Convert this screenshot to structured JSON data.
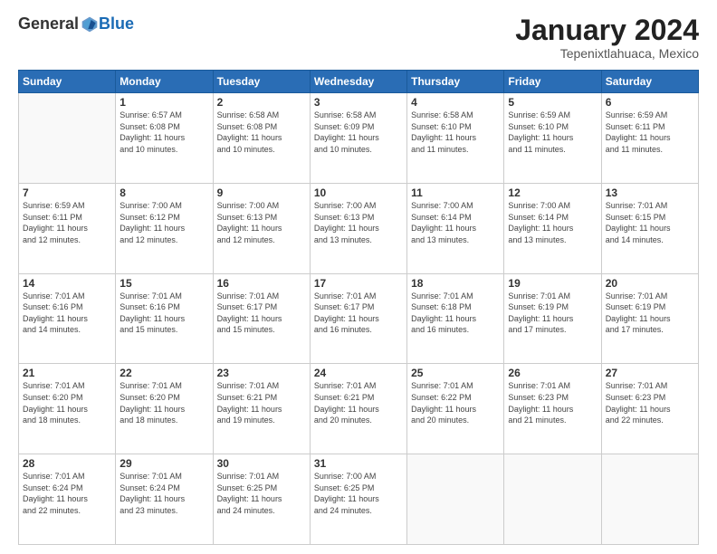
{
  "logo": {
    "general": "General",
    "blue": "Blue"
  },
  "header": {
    "month": "January 2024",
    "location": "Tepenixtlahuaca, Mexico"
  },
  "weekdays": [
    "Sunday",
    "Monday",
    "Tuesday",
    "Wednesday",
    "Thursday",
    "Friday",
    "Saturday"
  ],
  "weeks": [
    [
      {
        "day": "",
        "info": ""
      },
      {
        "day": "1",
        "info": "Sunrise: 6:57 AM\nSunset: 6:08 PM\nDaylight: 11 hours\nand 10 minutes."
      },
      {
        "day": "2",
        "info": "Sunrise: 6:58 AM\nSunset: 6:08 PM\nDaylight: 11 hours\nand 10 minutes."
      },
      {
        "day": "3",
        "info": "Sunrise: 6:58 AM\nSunset: 6:09 PM\nDaylight: 11 hours\nand 10 minutes."
      },
      {
        "day": "4",
        "info": "Sunrise: 6:58 AM\nSunset: 6:10 PM\nDaylight: 11 hours\nand 11 minutes."
      },
      {
        "day": "5",
        "info": "Sunrise: 6:59 AM\nSunset: 6:10 PM\nDaylight: 11 hours\nand 11 minutes."
      },
      {
        "day": "6",
        "info": "Sunrise: 6:59 AM\nSunset: 6:11 PM\nDaylight: 11 hours\nand 11 minutes."
      }
    ],
    [
      {
        "day": "7",
        "info": "Sunrise: 6:59 AM\nSunset: 6:11 PM\nDaylight: 11 hours\nand 12 minutes."
      },
      {
        "day": "8",
        "info": "Sunrise: 7:00 AM\nSunset: 6:12 PM\nDaylight: 11 hours\nand 12 minutes."
      },
      {
        "day": "9",
        "info": "Sunrise: 7:00 AM\nSunset: 6:13 PM\nDaylight: 11 hours\nand 12 minutes."
      },
      {
        "day": "10",
        "info": "Sunrise: 7:00 AM\nSunset: 6:13 PM\nDaylight: 11 hours\nand 13 minutes."
      },
      {
        "day": "11",
        "info": "Sunrise: 7:00 AM\nSunset: 6:14 PM\nDaylight: 11 hours\nand 13 minutes."
      },
      {
        "day": "12",
        "info": "Sunrise: 7:00 AM\nSunset: 6:14 PM\nDaylight: 11 hours\nand 13 minutes."
      },
      {
        "day": "13",
        "info": "Sunrise: 7:01 AM\nSunset: 6:15 PM\nDaylight: 11 hours\nand 14 minutes."
      }
    ],
    [
      {
        "day": "14",
        "info": "Sunrise: 7:01 AM\nSunset: 6:16 PM\nDaylight: 11 hours\nand 14 minutes."
      },
      {
        "day": "15",
        "info": "Sunrise: 7:01 AM\nSunset: 6:16 PM\nDaylight: 11 hours\nand 15 minutes."
      },
      {
        "day": "16",
        "info": "Sunrise: 7:01 AM\nSunset: 6:17 PM\nDaylight: 11 hours\nand 15 minutes."
      },
      {
        "day": "17",
        "info": "Sunrise: 7:01 AM\nSunset: 6:17 PM\nDaylight: 11 hours\nand 16 minutes."
      },
      {
        "day": "18",
        "info": "Sunrise: 7:01 AM\nSunset: 6:18 PM\nDaylight: 11 hours\nand 16 minutes."
      },
      {
        "day": "19",
        "info": "Sunrise: 7:01 AM\nSunset: 6:19 PM\nDaylight: 11 hours\nand 17 minutes."
      },
      {
        "day": "20",
        "info": "Sunrise: 7:01 AM\nSunset: 6:19 PM\nDaylight: 11 hours\nand 17 minutes."
      }
    ],
    [
      {
        "day": "21",
        "info": "Sunrise: 7:01 AM\nSunset: 6:20 PM\nDaylight: 11 hours\nand 18 minutes."
      },
      {
        "day": "22",
        "info": "Sunrise: 7:01 AM\nSunset: 6:20 PM\nDaylight: 11 hours\nand 18 minutes."
      },
      {
        "day": "23",
        "info": "Sunrise: 7:01 AM\nSunset: 6:21 PM\nDaylight: 11 hours\nand 19 minutes."
      },
      {
        "day": "24",
        "info": "Sunrise: 7:01 AM\nSunset: 6:21 PM\nDaylight: 11 hours\nand 20 minutes."
      },
      {
        "day": "25",
        "info": "Sunrise: 7:01 AM\nSunset: 6:22 PM\nDaylight: 11 hours\nand 20 minutes."
      },
      {
        "day": "26",
        "info": "Sunrise: 7:01 AM\nSunset: 6:23 PM\nDaylight: 11 hours\nand 21 minutes."
      },
      {
        "day": "27",
        "info": "Sunrise: 7:01 AM\nSunset: 6:23 PM\nDaylight: 11 hours\nand 22 minutes."
      }
    ],
    [
      {
        "day": "28",
        "info": "Sunrise: 7:01 AM\nSunset: 6:24 PM\nDaylight: 11 hours\nand 22 minutes."
      },
      {
        "day": "29",
        "info": "Sunrise: 7:01 AM\nSunset: 6:24 PM\nDaylight: 11 hours\nand 23 minutes."
      },
      {
        "day": "30",
        "info": "Sunrise: 7:01 AM\nSunset: 6:25 PM\nDaylight: 11 hours\nand 24 minutes."
      },
      {
        "day": "31",
        "info": "Sunrise: 7:00 AM\nSunset: 6:25 PM\nDaylight: 11 hours\nand 24 minutes."
      },
      {
        "day": "",
        "info": ""
      },
      {
        "day": "",
        "info": ""
      },
      {
        "day": "",
        "info": ""
      }
    ]
  ]
}
